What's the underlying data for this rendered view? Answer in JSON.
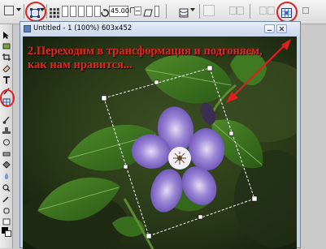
{
  "toolbar": {
    "angle_value": "45.00",
    "icons": [
      "options-icon",
      "transform-box-icon",
      "align-icon",
      "reference-point-icon",
      "rotate-icon",
      "skew-icon",
      "warp-icon",
      "transform-grid-icon"
    ]
  },
  "document": {
    "title": "Untitled - 1 (100%) 603x452",
    "caption": "2.Переходим в трансформация и подгоняем, как нам нравится..."
  },
  "colors": {
    "annotation": "#e02020",
    "caption": "#e6291f",
    "window_border": "#6f86a7",
    "titlebar": "#c9d6ea"
  }
}
